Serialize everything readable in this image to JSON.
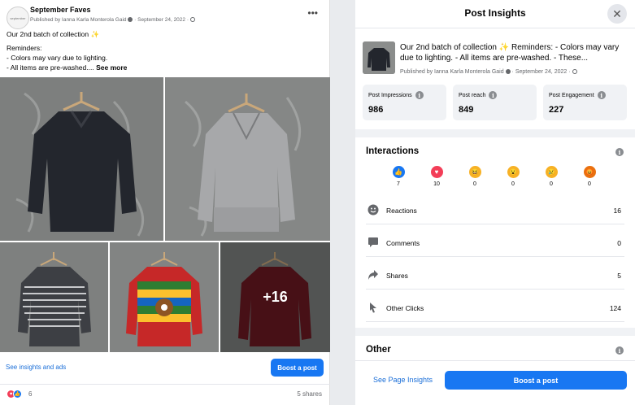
{
  "post": {
    "page_name": "September Faves",
    "avatar_text": "september",
    "meta": "Published by Ianna Karla Monterola Gaid",
    "date": "September 24, 2022",
    "more_label": "•••",
    "text_line1": "Our 2nd batch of collection",
    "text_line1_emoji": "✨",
    "text_line2": "Reminders:",
    "text_line3": "- Colors may vary due to lighting.",
    "text_line4": "- All items are pre-washed.... ",
    "see_more": "See more",
    "photo_overlay": "+16",
    "insights_link": "See insights and ads",
    "boost_label": "Boost a post",
    "reactions_count": "6",
    "shares": "5 shares",
    "colors": {
      "accent": "#1877f2",
      "link": "#1a6ed8"
    }
  },
  "insights": {
    "title": "Post Insights",
    "close_icon": "✕",
    "post_text": "Our 2nd batch of collection ✨ Reminders: - Colors may vary due to lighting. - All items are pre-washed. - These...",
    "post_meta": "Published by Ianna Karla Monterola Gaid",
    "post_date": "September 24, 2022",
    "metrics": [
      {
        "label": "Post Impressions",
        "value": "986"
      },
      {
        "label": "Post reach",
        "value": "849"
      },
      {
        "label": "Post Engagement",
        "value": "227"
      }
    ],
    "interactions_title": "Interactions",
    "reactions": [
      {
        "icon": "like-icon",
        "count": "7"
      },
      {
        "icon": "love-icon",
        "count": "10"
      },
      {
        "icon": "haha-icon",
        "count": "0"
      },
      {
        "icon": "wow-icon",
        "count": "0"
      },
      {
        "icon": "sad-icon",
        "count": "0"
      },
      {
        "icon": "angry-icon",
        "count": "0"
      }
    ],
    "stats": [
      {
        "icon": "smiley-icon",
        "label": "Reactions",
        "value": "16"
      },
      {
        "icon": "comment-icon",
        "label": "Comments",
        "value": "0"
      },
      {
        "icon": "share-icon",
        "label": "Shares",
        "value": "5"
      },
      {
        "icon": "cursor-icon",
        "label": "Other Clicks",
        "value": "124"
      }
    ],
    "other_title": "Other",
    "see_page_insights": "See Page Insights",
    "boost_label": "Boost a post"
  }
}
